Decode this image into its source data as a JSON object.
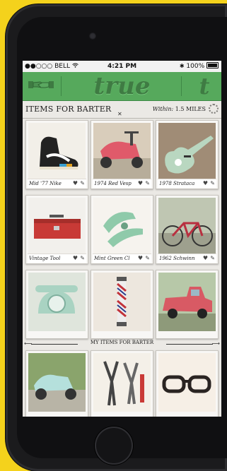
{
  "status_bar": {
    "carrier": "●●○○○ BELL",
    "wifi_icon": "wifi-icon",
    "time": "4:21 PM",
    "battery": "100%"
  },
  "nav": {
    "left_icon": "handshake-icon",
    "brand": "true",
    "right_initial": "t"
  },
  "barter_section": {
    "title": "ITEMS FOR BARTER",
    "within_label": "Within:",
    "distance": "1.5 MILES"
  },
  "items": [
    {
      "caption": "Mid '77 Nike",
      "theme": "sneaker"
    },
    {
      "caption": "1974 Red Vesp",
      "theme": "vespa"
    },
    {
      "caption": "1978 Strataca",
      "theme": "guitar"
    },
    {
      "caption": "Vintage Tool",
      "theme": "toolbox"
    },
    {
      "caption": "Mint Green Cl",
      "theme": "clamps"
    },
    {
      "caption": "1962 Schwinn",
      "theme": "bicycle"
    },
    {
      "caption": "",
      "theme": "phone"
    },
    {
      "caption": "",
      "theme": "barber"
    },
    {
      "caption": "",
      "theme": "truck"
    }
  ],
  "my_items_section": {
    "title": "MY ITEMS FOR BARTER"
  },
  "my_items": [
    {
      "theme": "scooter"
    },
    {
      "theme": "pliers"
    },
    {
      "theme": "glasses"
    }
  ],
  "colors": {
    "nav_green": "#56a95c",
    "brand_green": "#3f7b43",
    "phone_body": "#1b1b1d",
    "background_yellow": "#f4d21c"
  }
}
